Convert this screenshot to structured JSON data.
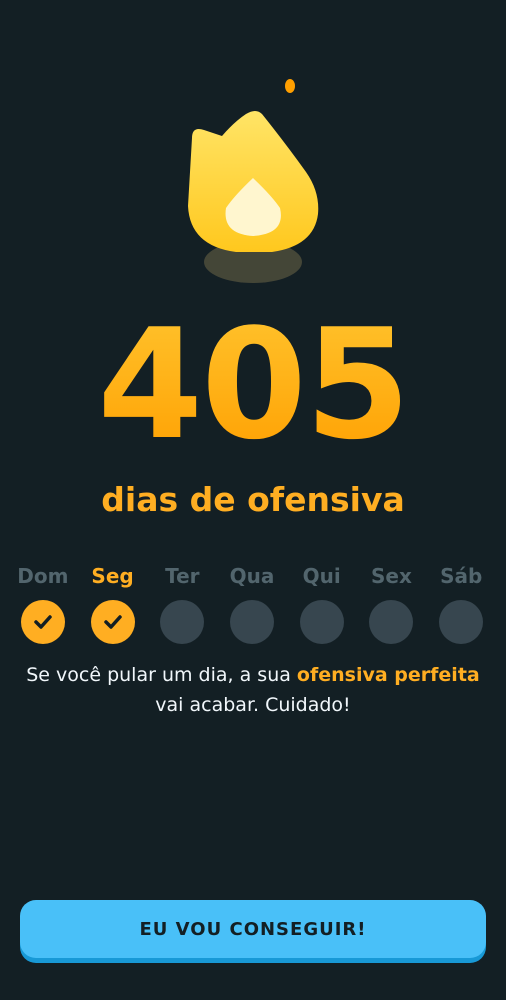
{
  "streak": {
    "count": "405",
    "label": "dias de ofensiva"
  },
  "week": {
    "days": [
      {
        "label": "Dom",
        "done": true
      },
      {
        "label": "Seg",
        "done": true,
        "today": true
      },
      {
        "label": "Ter",
        "done": false
      },
      {
        "label": "Qua",
        "done": false
      },
      {
        "label": "Qui",
        "done": false
      },
      {
        "label": "Sex",
        "done": false
      },
      {
        "label": "Sáb",
        "done": false
      }
    ]
  },
  "message": {
    "before": "Se você pular um dia, a sua ",
    "highlight": "ofensiva perfeita",
    "after": " vai acabar. Cuidado!"
  },
  "cta": {
    "label": "EU VOU CONSEGUIR!"
  },
  "icons": {
    "flame": "flame-icon",
    "check": "checkmark-icon"
  },
  "colors": {
    "background": "#131f24",
    "accent": "#ffae22",
    "inactive_day": "#37464f",
    "inactive_text": "#52656d",
    "button": "#49c0f8",
    "button_shadow": "#1899d6"
  }
}
